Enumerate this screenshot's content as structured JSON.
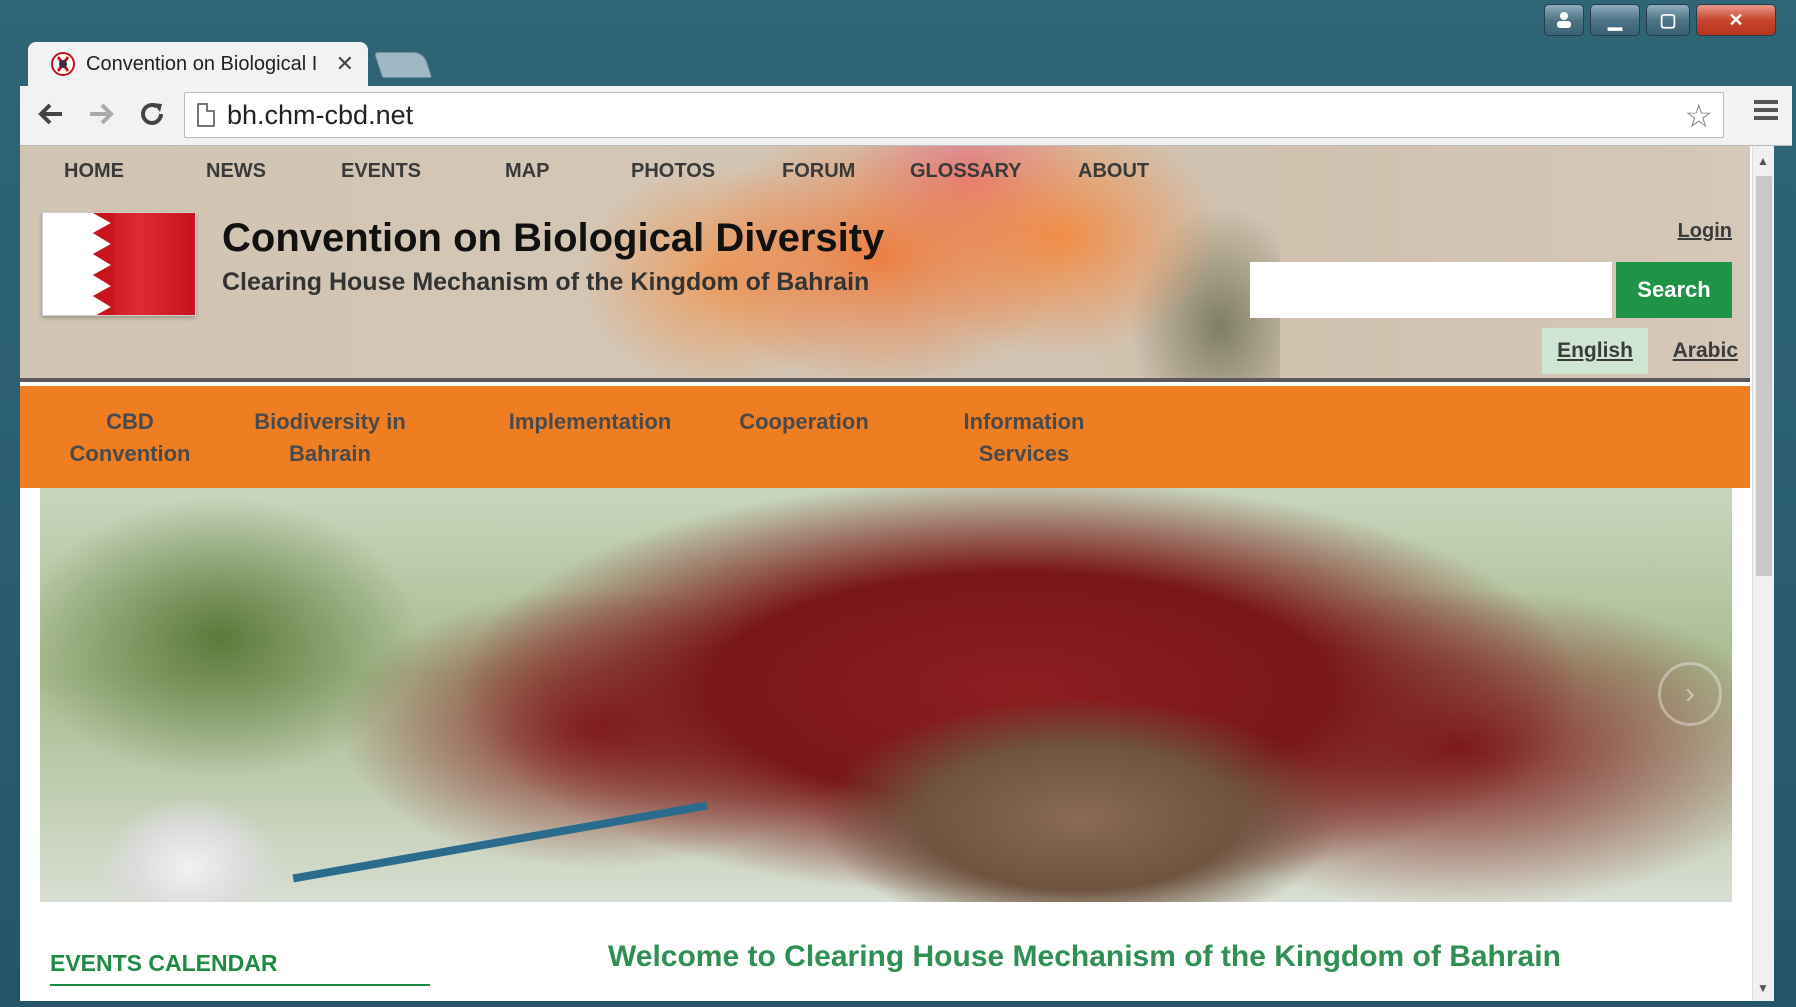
{
  "browser": {
    "tab_title": "Convention on Biological I",
    "tab_close": "✕",
    "url": "bh.chm-cbd.net"
  },
  "window_controls": {
    "minimize": "▁",
    "maximize": "▢",
    "close": "✕"
  },
  "top_nav": [
    {
      "label": "HOME"
    },
    {
      "label": "NEWS"
    },
    {
      "label": "EVENTS"
    },
    {
      "label": "MAP"
    },
    {
      "label": "PHOTOS"
    },
    {
      "label": "FORUM"
    },
    {
      "label": "GLOSSARY"
    },
    {
      "label": "ABOUT"
    }
  ],
  "header": {
    "title": "Convention on Biological Diversity",
    "subtitle": "Clearing House Mechanism of the Kingdom of Bahrain",
    "login": "Login",
    "search_value": "",
    "search_button": "Search",
    "lang_english": "English",
    "lang_arabic": "Arabic"
  },
  "main_menu": [
    {
      "label": "CBD\nConvention"
    },
    {
      "label": "Biodiversity in\nBahrain"
    },
    {
      "label": "Implementation"
    },
    {
      "label": "Cooperation"
    },
    {
      "label": "Information\nServices"
    }
  ],
  "content": {
    "events_heading": "EVENTS CALENDAR",
    "welcome": "Welcome to Clearing House Mechanism of the Kingdom of Bahrain"
  },
  "colors": {
    "accent_orange": "#ef7d22",
    "accent_green": "#1f9446",
    "heading_green": "#2f8f55"
  }
}
